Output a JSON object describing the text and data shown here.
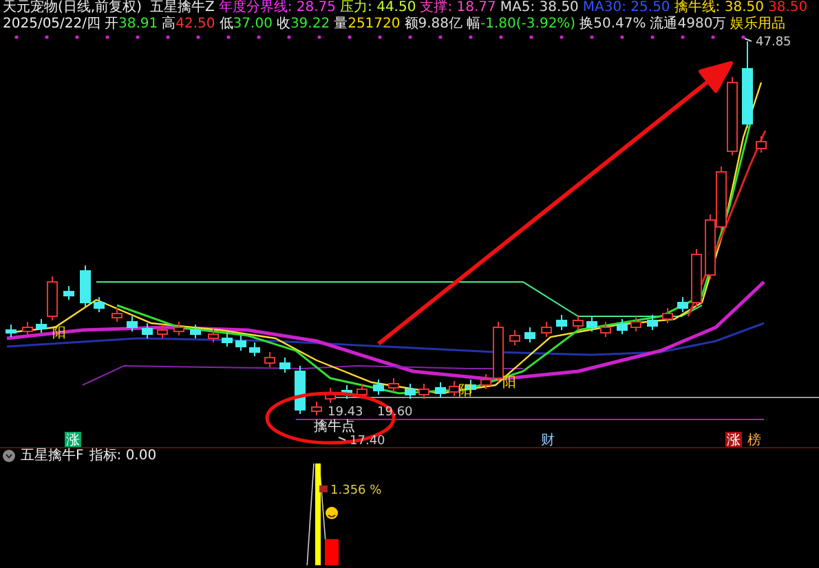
{
  "header": {
    "title": "天元宠物(日线,前复权)",
    "indicator": "五星擒牛Z",
    "values": [
      {
        "label": "年度分界线:",
        "value": "28.75",
        "color": "#ff33ff"
      },
      {
        "label": "压力:",
        "value": "44.50",
        "color": "#ccff33"
      },
      {
        "label": "支撑:",
        "value": "18.77",
        "color": "#ff44cc"
      },
      {
        "label": "MA5:",
        "value": "38.50",
        "color": "#dddddd"
      },
      {
        "label": "MA30:",
        "value": "25.50",
        "color": "#3355ff"
      },
      {
        "label": "擒牛线:",
        "value": "38.50",
        "color": "#ffdd00"
      },
      {
        "value": "38.50",
        "color": "#ff2222"
      }
    ]
  },
  "quote": {
    "date": "2025/05/22/四",
    "items": [
      {
        "label": "开",
        "value": "38.91",
        "color": "#33ee33"
      },
      {
        "label": "高",
        "value": "42.50",
        "color": "#ff3333"
      },
      {
        "label": "低",
        "value": "37.00",
        "color": "#33ee33"
      },
      {
        "label": "收",
        "value": "39.22",
        "color": "#33ee33"
      },
      {
        "label": "量",
        "value": "251720",
        "color": "#ffdd00"
      },
      {
        "label": "额",
        "value": "9.88亿",
        "color": "#dddddd"
      },
      {
        "label": "幅",
        "value": "-1.80(-3.92%)",
        "color": "#33ee33"
      },
      {
        "label": "换",
        "value": "50.47%",
        "color": "#dddddd"
      },
      {
        "label": "流通",
        "value": "4980万",
        "color": "#dddddd"
      }
    ],
    "sector": "娱乐用品"
  },
  "chart": {
    "labels": [
      {
        "kind": "price",
        "text": "47.85"
      },
      {
        "kind": "price",
        "text": "19.43"
      },
      {
        "kind": "price",
        "text": "19.60"
      },
      {
        "kind": "note",
        "text": "擒牛点"
      },
      {
        "kind": "price",
        "text": "17.40"
      },
      {
        "kind": "yang",
        "text": "阳"
      },
      {
        "kind": "yang",
        "text": "阳"
      },
      {
        "kind": "yang",
        "text": "阳"
      }
    ],
    "signals": [
      {
        "text": "涨",
        "color": "#00aa66"
      },
      {
        "text": "财",
        "color": "#000000"
      },
      {
        "text": "涨",
        "color": "#aa1111"
      },
      {
        "text": "榜",
        "color": "#000000"
      }
    ]
  },
  "lower_panel": {
    "title": "五星擒牛F",
    "reading": "指标: 0.00",
    "annotation": "1.356 %"
  }
}
